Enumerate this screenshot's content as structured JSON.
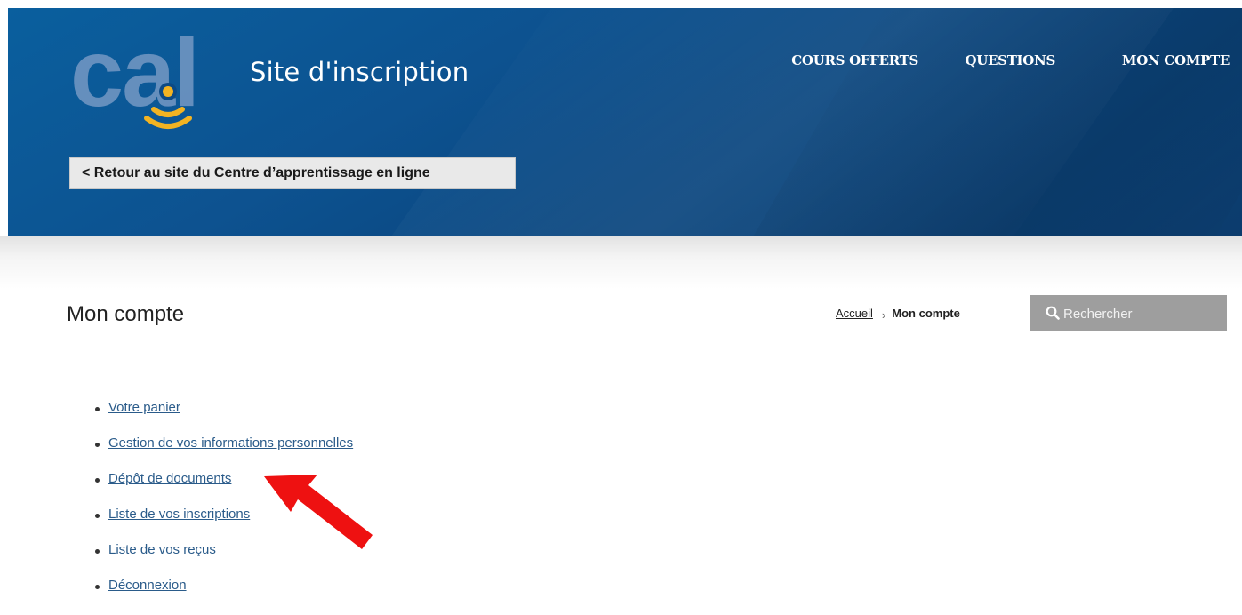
{
  "header": {
    "logo_text": "cal",
    "site_title": "Site d'inscription",
    "nav": [
      "COURS OFFERTS",
      "QUESTIONS",
      "MON COMPTE"
    ],
    "back_link": "< Retour au site du Centre d’apprentissage en ligne"
  },
  "page": {
    "title": "Mon compte"
  },
  "breadcrumb": {
    "home": "Accueil",
    "separator": "›",
    "current": "Mon compte"
  },
  "search": {
    "placeholder": "Rechercher",
    "icon": "search-icon"
  },
  "account_menu": [
    "Votre panier",
    "Gestion de vos informations personnelles",
    "Dépôt de documents",
    "Liste de vos inscriptions",
    "Liste de vos reçus",
    "Déconnexion"
  ],
  "colors": {
    "banner": "#0d5290",
    "logo_letters": "#6f95c2",
    "logo_waves": "#f2b322",
    "annotation_arrow": "#ee1111",
    "link": "#2a5b8a",
    "search_bg": "#9e9e9e"
  }
}
